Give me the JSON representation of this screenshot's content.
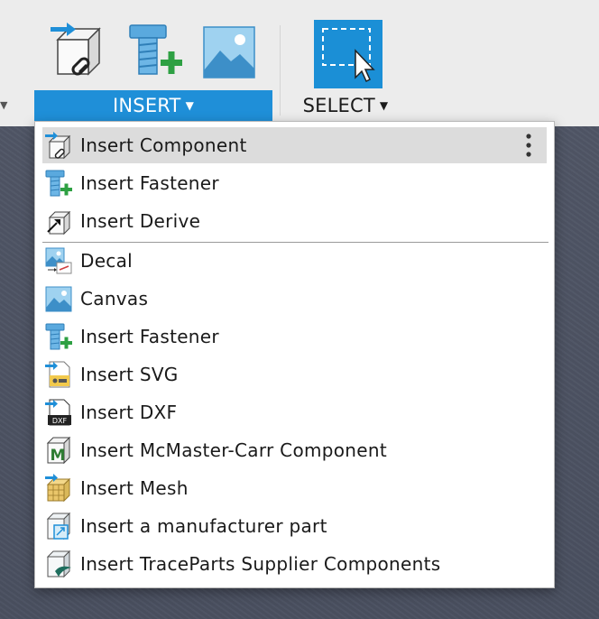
{
  "toolbar": {
    "insert_label": "INSERT",
    "select_label": "SELECT",
    "caret": "▼",
    "left_arrow": "▼",
    "buttons": [
      "insert-component-icon",
      "insert-fastener-icon",
      "canvas-icon",
      "select-window-icon"
    ]
  },
  "menu": {
    "items": [
      {
        "label": "Insert Component",
        "icon": "insert-component-icon"
      },
      {
        "label": "Insert Fastener",
        "icon": "insert-fastener-icon"
      },
      {
        "label": "Insert Derive",
        "icon": "insert-derive-icon"
      },
      {
        "label": "Decal",
        "icon": "decal-icon"
      },
      {
        "label": "Canvas",
        "icon": "canvas-icon"
      },
      {
        "label": "Insert Fastener",
        "icon": "insert-fastener-icon"
      },
      {
        "label": "Insert SVG",
        "icon": "insert-svg-icon"
      },
      {
        "label": "Insert DXF",
        "icon": "insert-dxf-icon"
      },
      {
        "label": "Insert McMaster-Carr Component",
        "icon": "mcmaster-icon"
      },
      {
        "label": "Insert Mesh",
        "icon": "insert-mesh-icon"
      },
      {
        "label": "Insert a manufacturer part",
        "icon": "manufacturer-part-icon"
      },
      {
        "label": "Insert TraceParts Supplier Components",
        "icon": "traceparts-icon"
      }
    ],
    "dxf_icon_text": "DXF",
    "mcmaster_icon_text": "M"
  },
  "colors": {
    "accent": "#1f8fd8",
    "highlight": "#dcdcdc",
    "canvas": "#4e5463",
    "plus_green": "#2ea043"
  }
}
